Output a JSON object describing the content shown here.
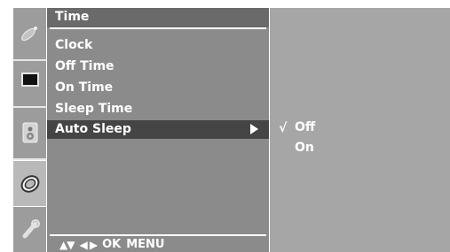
{
  "menu": {
    "title": "Time",
    "items": [
      {
        "label": "Clock"
      },
      {
        "label": "Off Time"
      },
      {
        "label": "On Time"
      },
      {
        "label": "Sleep Time"
      },
      {
        "label": "Auto Sleep",
        "selected": true
      }
    ]
  },
  "submenu": {
    "check_mark": "√",
    "options": [
      {
        "label": "Off",
        "checked": true
      },
      {
        "label": "On",
        "checked": false
      }
    ]
  },
  "footer": {
    "updown_glyph": "▲▼",
    "leftright_glyph": "◀ ▶",
    "ok_label": "OK",
    "menu_label": "MENU"
  },
  "sidebar": {
    "icons": [
      "satellite-dish-icon",
      "picture-icon",
      "speaker-icon",
      "clock-icon",
      "option-icon"
    ],
    "active_index": 3
  },
  "colors": {
    "menu_panel": "#8b8b8b",
    "title_bar": "#6a6a6a",
    "selected_row": "#454545",
    "submenu_panel": "#a6a6a6",
    "text": "#ffffff"
  }
}
